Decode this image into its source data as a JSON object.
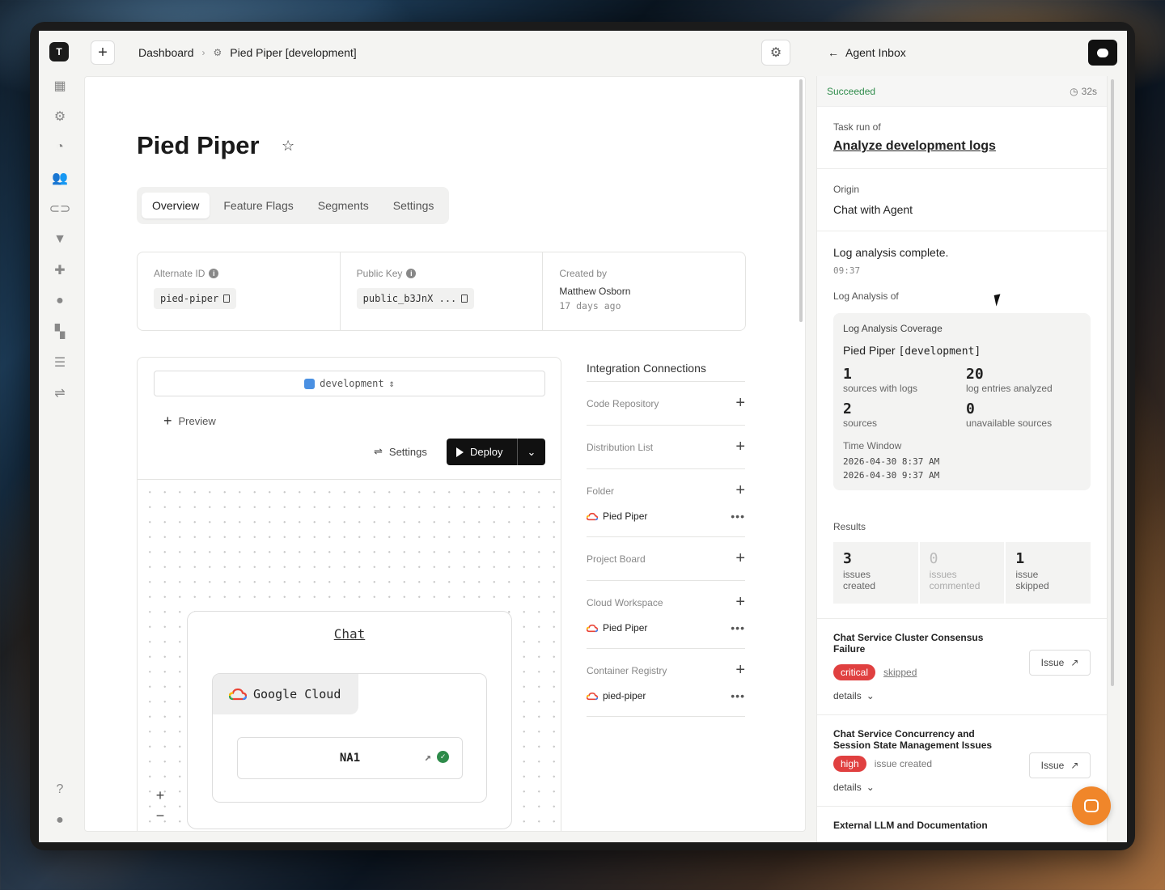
{
  "app": {
    "logo_letter": "T"
  },
  "topbar": {
    "breadcrumbs": [
      "Dashboard",
      "Pied Piper [development]"
    ],
    "inbox_title": "Agent Inbox"
  },
  "rail": {
    "icons": [
      "dashboard-icon",
      "projects-icon",
      "feeds-icon",
      "team-icon",
      "link-icon",
      "vercel-icon",
      "cloud-icon",
      "location-icon",
      "apps-icon",
      "document-icon",
      "sliders-icon"
    ]
  },
  "page": {
    "title": "Pied Piper",
    "tabs": [
      "Overview",
      "Feature Flags",
      "Segments",
      "Settings"
    ],
    "active_tab": "Overview",
    "meta": {
      "alternate_id_label": "Alternate ID",
      "alternate_id": "pied-piper",
      "public_key_label": "Public Key",
      "public_key": "public_b3JnX ...",
      "created_by_label": "Created by",
      "created_by": "Matthew Osborn",
      "created_ago": "17 days ago"
    }
  },
  "canvas": {
    "environment": "development",
    "preview_label": "Preview",
    "settings_label": "Settings",
    "deploy_label": "Deploy",
    "node_title": "Chat",
    "provider": "Google Cloud",
    "region": "NA1",
    "zoom_in": "+",
    "zoom_out": "−"
  },
  "integrations": {
    "title": "Integration Connections",
    "sections": [
      {
        "label": "Code Repository",
        "items": []
      },
      {
        "label": "Distribution List",
        "items": []
      },
      {
        "label": "Folder",
        "items": [
          "Pied Piper"
        ]
      },
      {
        "label": "Project Board",
        "items": []
      },
      {
        "label": "Cloud Workspace",
        "items": [
          "Pied Piper"
        ]
      },
      {
        "label": "Container Registry",
        "items": [
          "pied-piper"
        ]
      }
    ]
  },
  "inbox": {
    "status": "Succeeded",
    "duration": "32s",
    "task_label": "Task run of",
    "task_link": "Analyze development logs",
    "origin_label": "Origin",
    "origin": "Chat with Agent",
    "message": "Log analysis complete.",
    "message_time": "09:37",
    "analysis_label": "Log Analysis of",
    "coverage": {
      "title": "Log Analysis Coverage",
      "project": "Pied Piper",
      "env": "[development]",
      "stats": [
        {
          "n": "1",
          "label": "sources with logs"
        },
        {
          "n": "20",
          "label": "log entries analyzed"
        },
        {
          "n": "2",
          "label": "sources"
        },
        {
          "n": "0",
          "label": "unavailable sources"
        }
      ],
      "window_label": "Time Window",
      "window_start": "2026-04-30 8:37 AM",
      "window_end": "2026-04-30 9:37 AM"
    },
    "results_label": "Results",
    "results": [
      {
        "n": "3",
        "l1": "issues",
        "l2": "created"
      },
      {
        "n": "0",
        "l1": "issues",
        "l2": "commented"
      },
      {
        "n": "1",
        "l1": "issue",
        "l2": "skipped"
      }
    ],
    "issues": [
      {
        "title": "Chat Service Cluster Consensus Failure",
        "severity": "critical",
        "status": "skipped",
        "details": "details",
        "button": "Issue"
      },
      {
        "title": "Chat Service Concurrency and Session State Management Issues",
        "severity": "high",
        "status": "issue created",
        "details": "details",
        "button": "Issue"
      },
      {
        "title": "External LLM and Documentation"
      }
    ]
  }
}
